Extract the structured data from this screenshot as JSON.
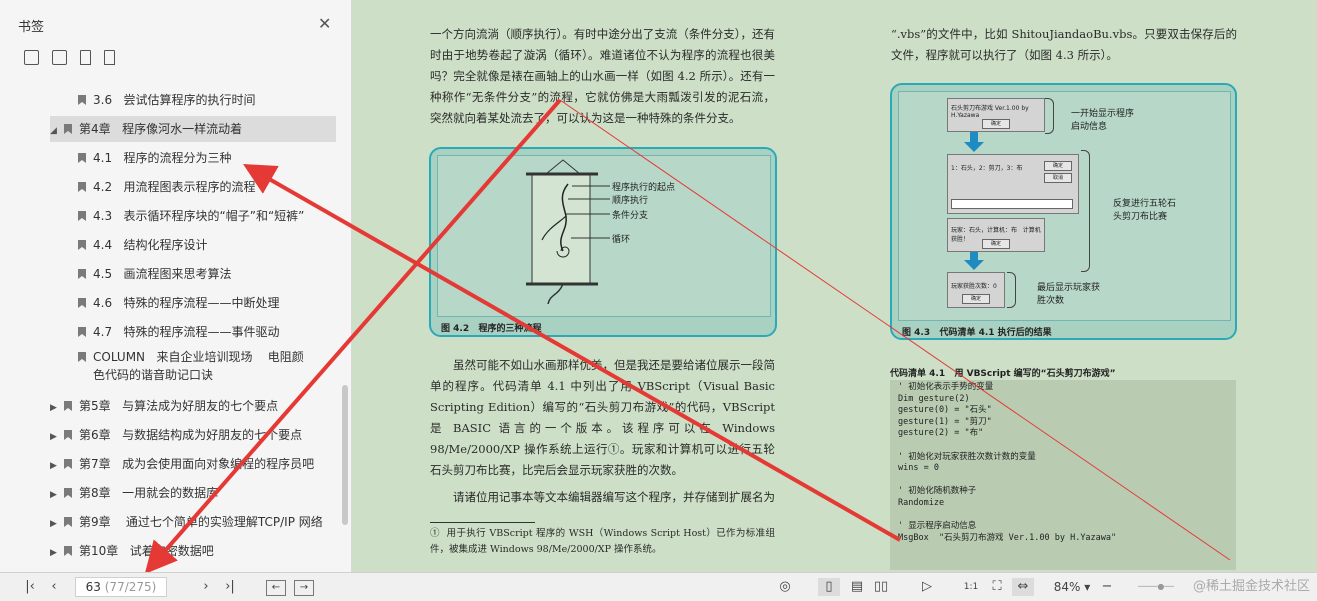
{
  "sidebar": {
    "title": "书签",
    "items": [
      {
        "label": "3.6   尝试估算程序的执行时间",
        "level": 1
      },
      {
        "label": "第4章   程序像河水一样流动着",
        "level": 0,
        "expanded": true,
        "selected": true
      },
      {
        "label": "4.1   程序的流程分为三种",
        "level": 1
      },
      {
        "label": "4.2   用流程图表示程序的流程",
        "level": 1
      },
      {
        "label": "4.3   表示循环程序块的“帽子”和“短裤”",
        "level": 1
      },
      {
        "label": "4.4   结构化程序设计",
        "level": 1
      },
      {
        "label": "4.5   画流程图来思考算法",
        "level": 1
      },
      {
        "label": "4.6   特殊的程序流程——中断处理",
        "level": 1
      },
      {
        "label": "4.7   特殊的程序流程——事件驱动",
        "level": 1
      },
      {
        "label": "COLUMN   来自企业培训现场    电阻颜",
        "label2": "色代码的谐音助记口诀",
        "level": 1
      },
      {
        "label": "第5章   与算法成为好朋友的七个要点",
        "level": 0
      },
      {
        "label": "第6章   与数据结构成为好朋友的七个要点",
        "level": 0
      },
      {
        "label": "第7章   成为会使用面向对象编程的程序员吧",
        "level": 0
      },
      {
        "label": "第8章   一用就会的数据库",
        "level": 0
      },
      {
        "label": "第9章    通过七个简单的实验理解TCP/IP 网络",
        "level": 0
      },
      {
        "label": "第10章   试着加密数据吧",
        "level": 0
      }
    ]
  },
  "page": {
    "left_para1": "一个方向流淌（顺序执行）。有时中途分出了支流（条件分支），还有时由于地势卷起了漩涡（循环）。难道诸位不认为程序的流程也很美吗？完全就像是裱在画轴上的山水画一样（如图 4.2 所示）。还有一种称作“无条件分支”的流程，它就仿佛是大雨瓢泼引发的泥石流，突然就向着某处流去了，可以认为这是一种特殊的条件分支。",
    "fig42_caption": "图 4.2   程序的三种流程",
    "fig42_labels": [
      "程序执行的起点",
      "顺序执行",
      "条件分支",
      "循环"
    ],
    "left_para2": "虽然可能不如山水画那样优美，但是我还是要给诸位展示一段简单的程序。代码清单 4.1 中列出了用 VBScript（Visual Basic Scripting Edition）编写的“石头剪刀布游戏”的代码，VBScript 是 BASIC 语言的一个版本。该程序可以在 Windows 98/Me/2000/XP 操作系统上运行①。玩家和计算机可以进行五轮石头剪刀布比赛，比完后会显示玩家获胜的次数。",
    "left_para3": "请诸位用记事本等文本编辑器编写这个程序，并存储到扩展名为",
    "footnote": "①  用于执行 VBScript 程序的 WSH（Windows Script Host）已作为标准组件，被集成进 Windows 98/Me/2000/XP 操作系统。",
    "right_para1": "“.vbs”的文件中，比如 ShitouJiandaoBu.vbs。只要双击保存后的文件，程序就可以执行了（如图 4.3 所示）。",
    "fig43_caption": "图 4.3   代码清单 4.1 执行后的结果",
    "fig43_labels": [
      "一开始显示程序启动信息",
      "反复进行五轮石头剪刀布比赛",
      "最后显示玩家获胜次数"
    ],
    "fig43_win1_title": "石头剪刀布游戏 Ver.1.00 by H.Yazawa",
    "fig43_win2_text": "1：石头，2：剪刀，3：布",
    "fig43_win3_text": "玩家：石头，计算机：布   计算机获胜！",
    "fig43_win4_text": "玩家获胜次数：0",
    "fig43_ok": "确定",
    "fig43_cancel": "取消",
    "code_title": "代码清单 4.1   用 VBScript 编写的“石头剪刀布游戏”",
    "code_lines": [
      "' 初始化表示手势的变量",
      "Dim gesture(2)",
      "gesture(0) = \"石头\"",
      "gesture(1) = \"剪刀\"",
      "gesture(2) = \"布\"",
      "",
      "' 初始化对玩家获胜次数计数的变量",
      "wins = 0",
      "",
      "' 初始化随机数种子",
      "Randomize",
      "",
      "' 显示程序启动信息",
      "MsgBox  \"石头剪刀布游戏 Ver.1.00 by H.Yazawa\""
    ]
  },
  "bottombar": {
    "page_current": "63",
    "page_total": "(77/275)",
    "zoom": "84%",
    "watermark": "@稀土掘金技术社区"
  },
  "colors": {
    "page_bg": "#cde0c7",
    "figure_border": "#2aa9b8",
    "annotation_arrow": "#e53935"
  }
}
